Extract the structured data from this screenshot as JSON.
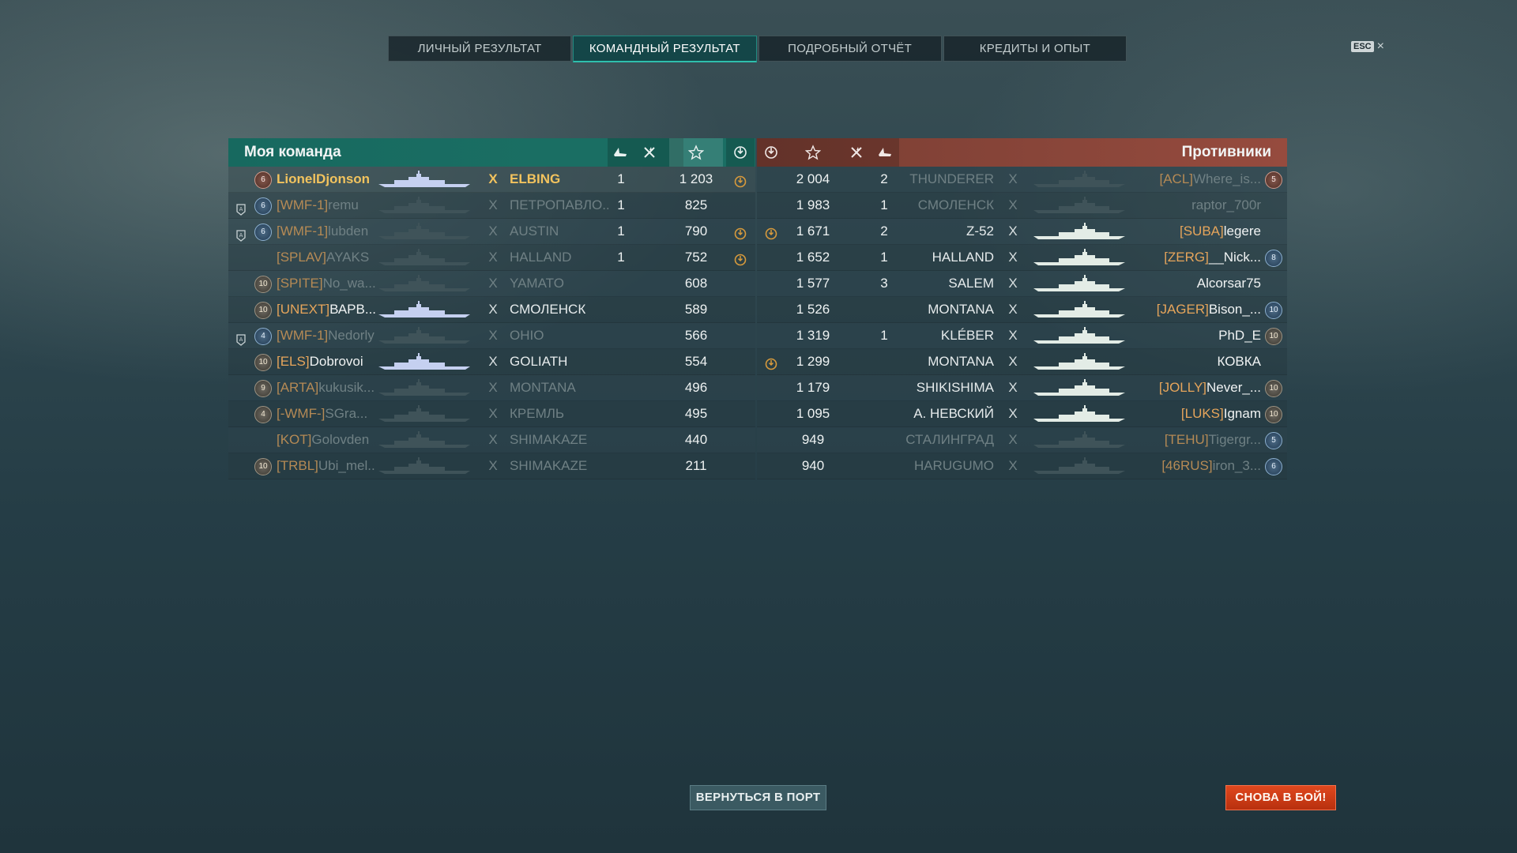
{
  "tabs": [
    {
      "label": "ЛИЧНЫЙ РЕЗУЛЬТАТ",
      "active": false
    },
    {
      "label": "КОМАНДНЫЙ РЕЗУЛЬТАТ",
      "active": true
    },
    {
      "label": "ПОДРОБНЫЙ ОТЧЁТ",
      "active": false
    },
    {
      "label": "КРЕДИТЫ И ОПЫТ",
      "active": false
    }
  ],
  "esc": {
    "key": "ESC",
    "close": "×"
  },
  "ally": {
    "title": "Моя команда",
    "columns": [
      "ship-kills-icon",
      "plane-kills-icon",
      "base-xp-star-icon",
      "capture-icon"
    ],
    "rows": [
      {
        "rank": "6",
        "rank_style": "red",
        "division": "",
        "clan": "",
        "nick": "LionelDjonson",
        "alive": true,
        "me": true,
        "mark": "X",
        "ship": "ELBING",
        "kills": "1",
        "xp": "1 203",
        "capture": true
      },
      {
        "rank": "6",
        "rank_style": "blue",
        "division": "A",
        "clan": "[WMF-1]",
        "nick": "remu",
        "alive": false,
        "me": false,
        "mark": "X",
        "ship": "ПЕТРОПАВЛО...",
        "kills": "1",
        "xp": "825",
        "capture": false
      },
      {
        "rank": "6",
        "rank_style": "blue",
        "division": "A",
        "clan": "[WMF-1]",
        "nick": "lubden",
        "alive": false,
        "me": false,
        "mark": "X",
        "ship": "AUSTIN",
        "kills": "1",
        "xp": "790",
        "capture": true
      },
      {
        "rank": "",
        "rank_style": "",
        "division": "",
        "clan": "[SPLAV]",
        "nick": "AYAKS",
        "alive": false,
        "me": false,
        "mark": "X",
        "ship": "HALLAND",
        "kills": "1",
        "xp": "752",
        "capture": true
      },
      {
        "rank": "10",
        "rank_style": "",
        "division": "",
        "clan": "[SPITE]",
        "nick": "No_wa...",
        "alive": false,
        "me": false,
        "mark": "X",
        "ship": "YAMATO",
        "kills": "",
        "xp": "608",
        "capture": false
      },
      {
        "rank": "10",
        "rank_style": "",
        "division": "",
        "clan": "[UNEXT]",
        "nick": "ВАРВ...",
        "alive": true,
        "me": false,
        "mark": "X",
        "ship": "СМОЛЕНСК",
        "kills": "",
        "xp": "589",
        "capture": false
      },
      {
        "rank": "4",
        "rank_style": "blue",
        "division": "A",
        "clan": "[WMF-1]",
        "nick": "Nedorly",
        "alive": false,
        "me": false,
        "mark": "X",
        "ship": "OHIO",
        "kills": "",
        "xp": "566",
        "capture": false
      },
      {
        "rank": "10",
        "rank_style": "",
        "division": "",
        "clan": "[ELS]",
        "nick": "Dobrovoi",
        "alive": true,
        "me": false,
        "mark": "X",
        "ship": "GOLIATH",
        "kills": "",
        "xp": "554",
        "capture": false
      },
      {
        "rank": "9",
        "rank_style": "",
        "division": "",
        "clan": "[ARTA]",
        "nick": "kukusik...",
        "alive": false,
        "me": false,
        "mark": "X",
        "ship": "MONTANA",
        "kills": "",
        "xp": "496",
        "capture": false
      },
      {
        "rank": "4",
        "rank_style": "",
        "division": "",
        "clan": "[-WMF-]",
        "nick": "SGra...",
        "alive": false,
        "me": false,
        "mark": "X",
        "ship": "КРЕМЛЬ",
        "kills": "",
        "xp": "495",
        "capture": false
      },
      {
        "rank": "",
        "rank_style": "",
        "division": "",
        "clan": "[KOT]",
        "nick": "Golovden",
        "alive": false,
        "me": false,
        "mark": "X",
        "ship": "SHIMAKAZE",
        "kills": "",
        "xp": "440",
        "capture": false
      },
      {
        "rank": "10",
        "rank_style": "",
        "division": "",
        "clan": "[TRBL]",
        "nick": "Ubi_mel...",
        "alive": false,
        "me": false,
        "mark": "X",
        "ship": "SHIMAKAZE",
        "kills": "",
        "xp": "211",
        "capture": false
      }
    ]
  },
  "enemy": {
    "title": "Противники",
    "columns": [
      "capture-icon",
      "base-xp-star-icon",
      "plane-kills-icon",
      "ship-kills-icon"
    ],
    "rows": [
      {
        "capture": false,
        "xp": "2 004",
        "kills": "2",
        "ship": "THUNDERER",
        "mark": "X",
        "clan": "[ACL]",
        "nick": "Where_is...",
        "alive": false,
        "rank": "5",
        "rank_style": "red"
      },
      {
        "capture": false,
        "xp": "1 983",
        "kills": "1",
        "ship": "СМОЛЕНСК",
        "mark": "X",
        "clan": "",
        "nick": "raptor_700r",
        "alive": false,
        "rank": "",
        "rank_style": ""
      },
      {
        "capture": true,
        "xp": "1 671",
        "kills": "2",
        "ship": "Z-52",
        "mark": "X",
        "clan": "[SUBA]",
        "nick": "legere",
        "alive": true,
        "rank": "",
        "rank_style": ""
      },
      {
        "capture": false,
        "xp": "1 652",
        "kills": "1",
        "ship": "HALLAND",
        "mark": "X",
        "clan": "[ZERG]",
        "nick": "__Nick...",
        "alive": true,
        "rank": "8",
        "rank_style": "blue"
      },
      {
        "capture": false,
        "xp": "1 577",
        "kills": "3",
        "ship": "SALEM",
        "mark": "X",
        "clan": "",
        "nick": "Alcorsar75",
        "alive": true,
        "rank": "",
        "rank_style": ""
      },
      {
        "capture": false,
        "xp": "1 526",
        "kills": "",
        "ship": "MONTANA",
        "mark": "X",
        "clan": "[JAGER]",
        "nick": "Bison_...",
        "alive": true,
        "rank": "10",
        "rank_style": "blue"
      },
      {
        "capture": false,
        "xp": "1 319",
        "kills": "1",
        "ship": "KLÉBER",
        "mark": "X",
        "clan": "",
        "nick": "PhD_E",
        "alive": true,
        "rank": "10",
        "rank_style": ""
      },
      {
        "capture": true,
        "xp": "1 299",
        "kills": "",
        "ship": "MONTANA",
        "mark": "X",
        "clan": "",
        "nick": "КОВКА",
        "alive": true,
        "rank": "",
        "rank_style": ""
      },
      {
        "capture": false,
        "xp": "1 179",
        "kills": "",
        "ship": "SHIKISHIMA",
        "mark": "X",
        "clan": "[JOLLY]",
        "nick": "Never_...",
        "alive": true,
        "rank": "10",
        "rank_style": ""
      },
      {
        "capture": false,
        "xp": "1 095",
        "kills": "",
        "ship": "А. НЕВСКИЙ",
        "mark": "X",
        "clan": "[LUKS]",
        "nick": "Ignam",
        "alive": true,
        "rank": "10",
        "rank_style": ""
      },
      {
        "capture": false,
        "xp": "949",
        "kills": "",
        "ship": "СТАЛИНГРАД",
        "mark": "X",
        "clan": "[TEHU]",
        "nick": "Tigergr...",
        "alive": false,
        "rank": "5",
        "rank_style": "blue"
      },
      {
        "capture": false,
        "xp": "940",
        "kills": "",
        "ship": "HARUGUMO",
        "mark": "X",
        "clan": "[46RUS]",
        "nick": "iron_3...",
        "alive": false,
        "rank": "6",
        "rank_style": "blue"
      }
    ]
  },
  "buttons": {
    "port": "ВЕРНУТЬСЯ В ПОРТ",
    "battle": "СНОВА В БОЙ!"
  },
  "colors": {
    "ally_header": "#1a6e63",
    "enemy_header": "#964b3e",
    "clan_tag": "#e6a55b",
    "me_highlight": "#f2c35e",
    "battle_button": "#d63d18"
  }
}
